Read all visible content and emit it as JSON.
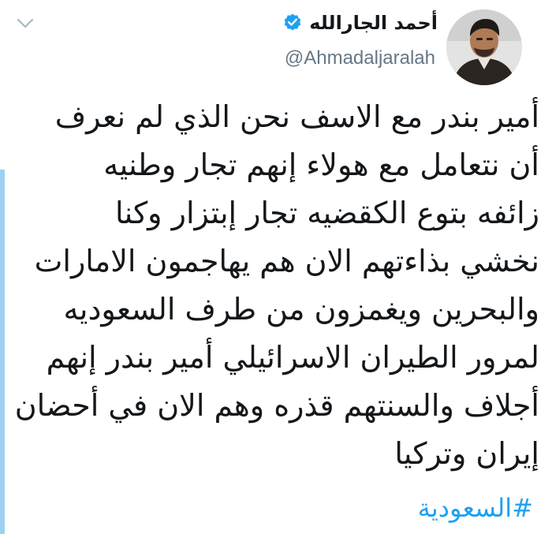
{
  "user": {
    "display_name": "أحمد الجارالله",
    "handle": "@Ahmadaljaralah",
    "verified": true,
    "avatar_icon": "profile-photo"
  },
  "tweet": {
    "lines": [
      "أمير بندر مع الاسف نحن الذي لم نعرف",
      "أن نتعامل مع هولاء إنهم تجار وطنيه",
      "زائفه بتوع الكقضيه تجار إبتزار وكنا",
      "نخشي بذاءتهم الان هم يهاجمون الامارات",
      "والبحرين ويغمزون من طرف السعوديه",
      "لمرور الطيران الاسرائيلي أمير بندر إنهم",
      "أجلاف والسنتهم قذره وهم الان في أحضان",
      "إيران وتركيا"
    ],
    "hashtag": "#السعودية"
  },
  "icons": {
    "menu": "chevron-down-icon",
    "verified": "verified-badge-icon"
  },
  "colors": {
    "accent": "#1da1f2",
    "text": "#14171a",
    "muted": "#657786",
    "thread_bar": "#9fd0f2"
  }
}
